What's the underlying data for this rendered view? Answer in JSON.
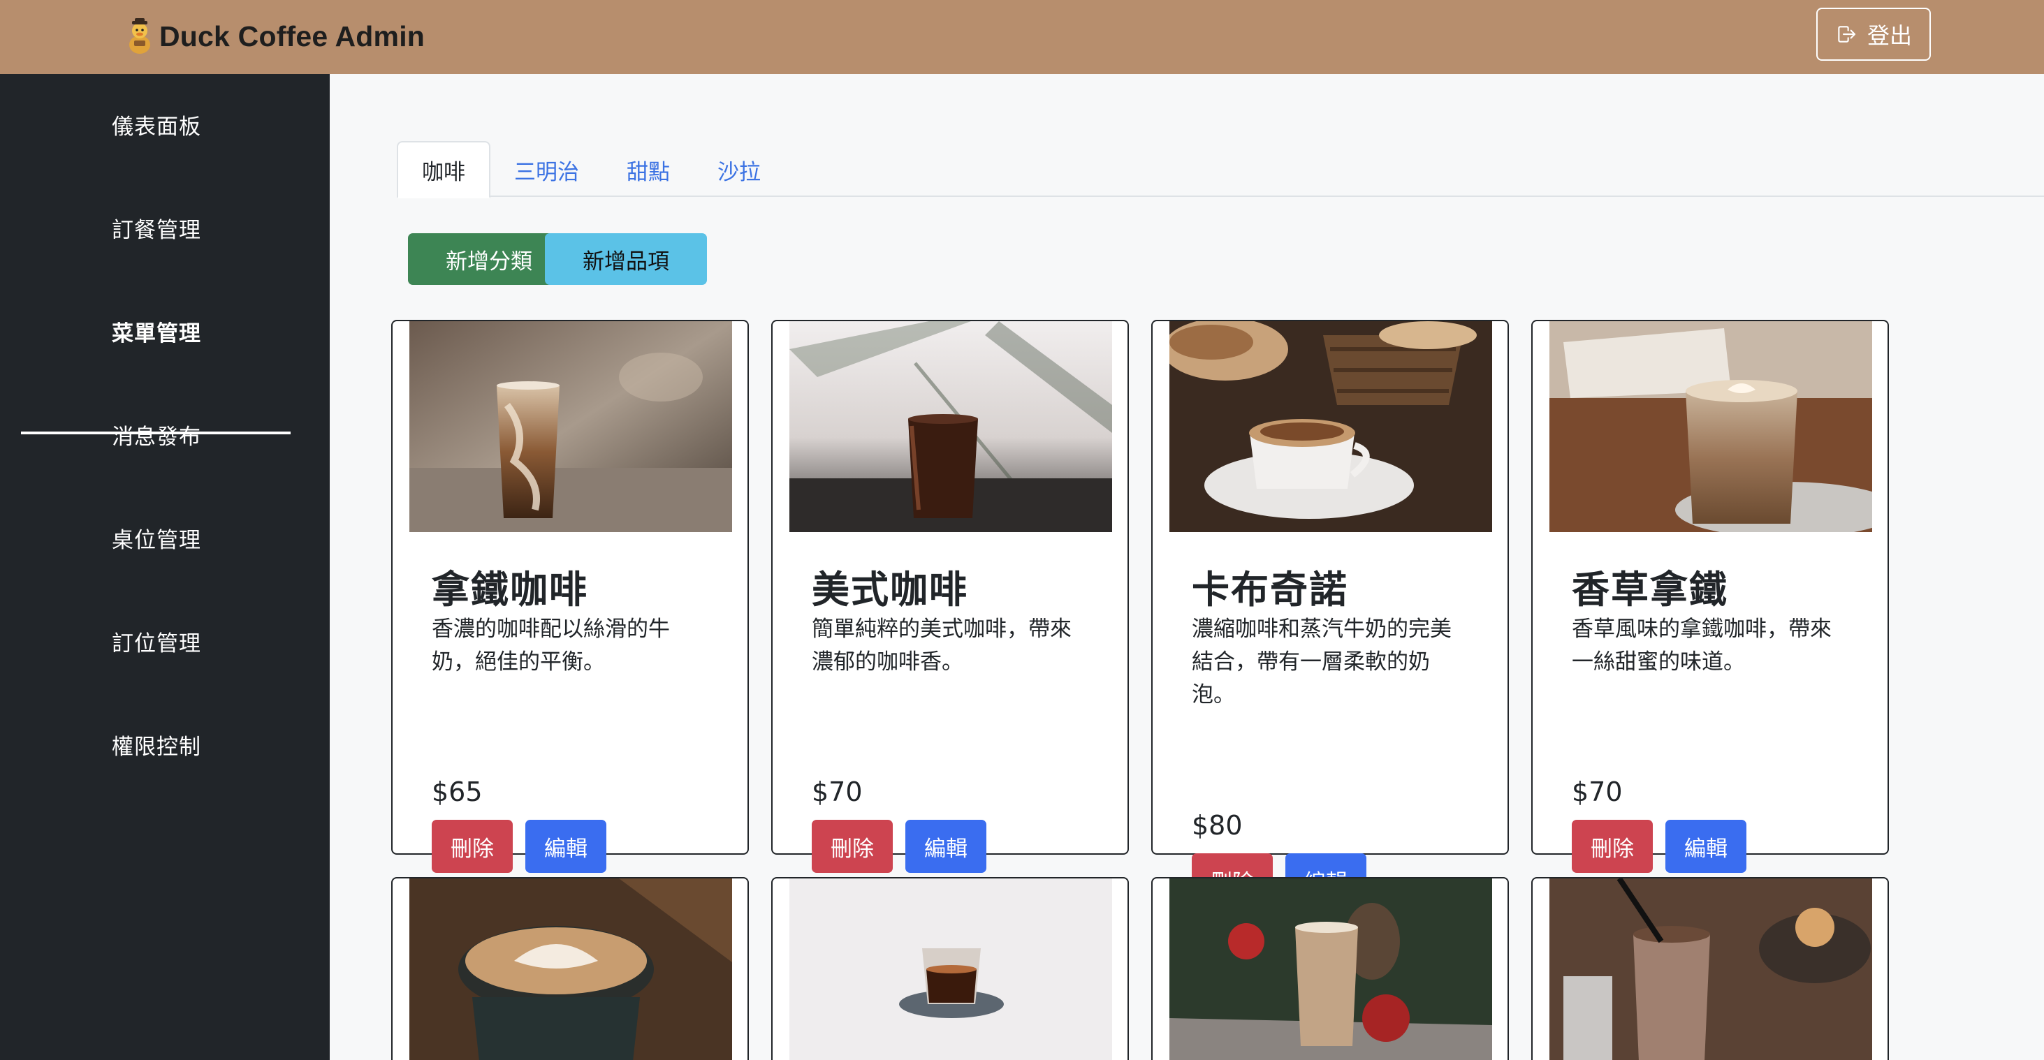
{
  "header": {
    "brand": "Duck Coffee Admin",
    "logout_label": "登出"
  },
  "sidebar": {
    "items": [
      {
        "label": "儀表面板"
      },
      {
        "label": "訂餐管理"
      },
      {
        "label": "菜單管理",
        "active": true
      },
      {
        "label": "消息發布"
      },
      {
        "label": "桌位管理"
      },
      {
        "label": "訂位管理"
      },
      {
        "label": "權限控制"
      }
    ]
  },
  "menu": {
    "tabs": [
      {
        "label": "咖啡",
        "active": true
      },
      {
        "label": "三明治"
      },
      {
        "label": "甜點"
      },
      {
        "label": "沙拉"
      }
    ],
    "add_category_label": "新增分類",
    "add_item_label": "新增品項",
    "delete_label": "刪除",
    "edit_label": "編輯",
    "items": [
      {
        "name": "拿鐵咖啡",
        "desc_lines": [
          "香濃的咖啡配以絲滑的牛",
          "奶，絕佳的平衡。"
        ],
        "price": "$65"
      },
      {
        "name": "美式咖啡",
        "desc_lines": [
          "簡單純粹的美式咖啡，帶來",
          "濃郁的咖啡香。"
        ],
        "price": "$70"
      },
      {
        "name": "卡布奇諾",
        "desc_lines": [
          "濃縮咖啡和蒸汽牛奶的完美",
          "結合，帶有一層柔軟的奶",
          "泡。"
        ],
        "price": "$80"
      },
      {
        "name": "香草拿鐵",
        "desc_lines": [
          "香草風味的拿鐵咖啡，帶來",
          "一絲甜蜜的味道。"
        ],
        "price": "$70"
      }
    ]
  },
  "colors": {
    "header_bg": "#b78e6d",
    "sidebar_bg": "#212529",
    "add_category": "#3d8554",
    "add_item": "#5bc2e7",
    "delete": "#cd4450",
    "edit": "#3a6df0",
    "tab_link": "#3b72e3"
  }
}
